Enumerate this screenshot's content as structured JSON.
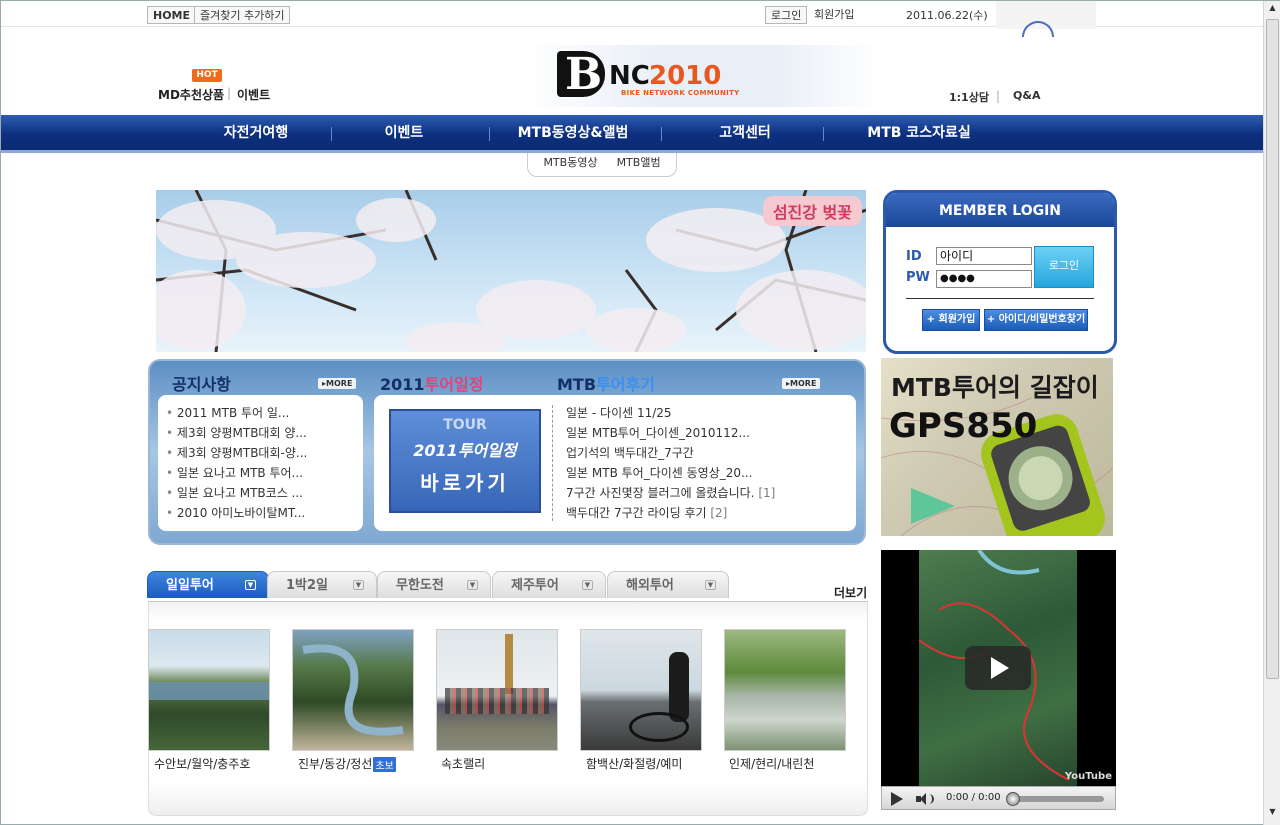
{
  "topbar": {
    "home_label": "HOME",
    "bookmark_label": "즐겨찾기 추가하기",
    "login_label": "로그인",
    "join_label": "회원가입",
    "date": "2011.06.22(수)"
  },
  "header": {
    "hot_badge": "HOT",
    "md_pick": "MD추천상품",
    "event": "이벤트",
    "logo_b": "B",
    "logo_nc": "NC",
    "logo_year": "2010",
    "logo_sub": "BIKE NETWORK COMMUNITY",
    "consult": "1:1상담",
    "qa": "Q&A"
  },
  "nav": {
    "items": [
      "자전거여행",
      "이벤트",
      "MTB동영상&앨범",
      "고객센터",
      "MTB 코스자료실"
    ],
    "sub": [
      "MTB동영상",
      "MTB앨범"
    ]
  },
  "banner": {
    "tag": "섬진강 벚꽃"
  },
  "login": {
    "title": "MEMBER LOGIN",
    "id_label": "ID",
    "pw_label": "PW",
    "id_value": "아이디",
    "pw_value": "●●●●",
    "submit": "로그인",
    "join": "+ 회원가입",
    "find": "+ 아이디/비밀번호찾기"
  },
  "gps_ad": {
    "line1": "MTB투어의 길잡이",
    "line2": "GPS850"
  },
  "notice": {
    "title": "공지사항",
    "more": "▸MORE",
    "items": [
      "2011 MTB 투어 일...",
      "제3회 양평MTB대회 양...",
      "제3회 양평MTB대회-양...",
      "일본 요나고 MTB 투어...",
      "일본 요나고 MTB코스 ...",
      "2010 아미노바이탈MT..."
    ]
  },
  "schedule": {
    "title_year": "2011",
    "title_text": "투어일정",
    "btn_tour": "TOUR",
    "btn_line1": "2011투어일정",
    "btn_line2": "바로가기"
  },
  "review": {
    "title_prefix": "MTB",
    "title_text": "투어후기",
    "more": "▸MORE",
    "items": [
      {
        "text": "일본 - 다이센 11/25",
        "count": ""
      },
      {
        "text": "일본 MTB투어_다이센_2010112...",
        "count": ""
      },
      {
        "text": "업기석의 백두대간_7구간",
        "count": ""
      },
      {
        "text": "일본 MTB 투어_다이센 동영상_20...",
        "count": ""
      },
      {
        "text": "7구간 사진몇장 블러그에 올렸습니다. ",
        "count": "[1]"
      },
      {
        "text": "백두대간 7구간 라이딩 후기 ",
        "count": "[2]"
      }
    ]
  },
  "tabs": {
    "items": [
      "일일투어",
      "1박2일",
      "무한도전",
      "제주투어",
      "해외투어"
    ],
    "more": "더보기"
  },
  "tours": [
    {
      "caption": "수안보/월악/충주호",
      "badge": ""
    },
    {
      "caption": "진부/동강/정선",
      "badge": "초보"
    },
    {
      "caption": "속초랠리",
      "badge": ""
    },
    {
      "caption": "함백산/화절령/예미",
      "badge": ""
    },
    {
      "caption": "인제/현리/내린천",
      "badge": ""
    }
  ],
  "video": {
    "time": "0:00 / 0:00",
    "brand": "YouTube"
  },
  "colors": {
    "nav_blue": "#0d2f7e",
    "accent_orange": "#e8581e",
    "pink": "#d23b5e"
  }
}
